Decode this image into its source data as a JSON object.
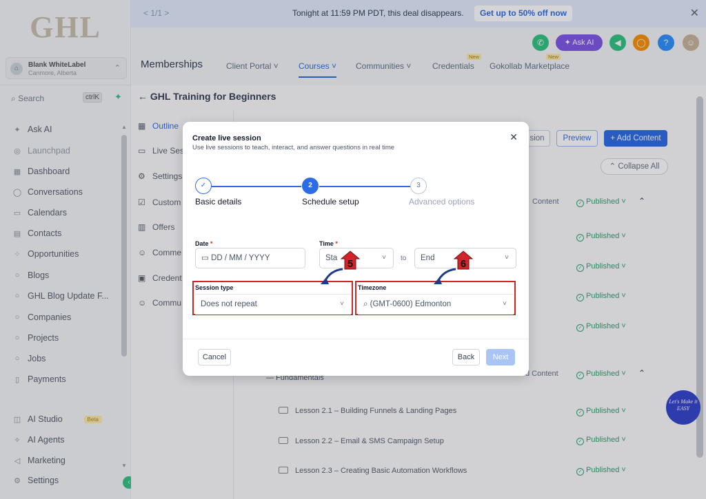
{
  "sidebar": {
    "logo": "GHL",
    "account_name": "Blank WhiteLabel",
    "account_location": "Canmore, Alberta",
    "search_placeholder": "Search",
    "search_shortcut": "ctrlK",
    "items": [
      {
        "label": "Ask AI",
        "icon": "sparkle-icon"
      },
      {
        "label": "Launchpad",
        "icon": "rocket-icon"
      },
      {
        "label": "Dashboard",
        "icon": "grid-icon"
      },
      {
        "label": "Conversations",
        "icon": "chat-icon"
      },
      {
        "label": "Calendars",
        "icon": "calendar-icon"
      },
      {
        "label": "Contacts",
        "icon": "contacts-icon"
      },
      {
        "label": "Opportunities",
        "icon": "funnel-icon"
      },
      {
        "label": "Blogs",
        "icon": "blog-icon"
      },
      {
        "label": "GHL Blog Update F...",
        "icon": "blog-icon"
      },
      {
        "label": "Companies",
        "icon": "building-icon"
      },
      {
        "label": "Projects",
        "icon": "project-icon"
      },
      {
        "label": "Jobs",
        "icon": "briefcase-icon"
      },
      {
        "label": "Payments",
        "icon": "payment-icon"
      },
      {
        "label": "AI Studio",
        "icon": "studio-icon",
        "badge": "Beta"
      },
      {
        "label": "AI Agents",
        "icon": "agents-icon"
      },
      {
        "label": "Marketing",
        "icon": "send-icon"
      },
      {
        "label": "Settings",
        "icon": "gear-icon"
      }
    ]
  },
  "banner": {
    "pager": "< 1/1 >",
    "message": "Tonight at 11:59 PM PDT, this deal disappears.",
    "cta": "Get up to 50% off now"
  },
  "header": {
    "ask_ai": "Ask AI",
    "section_title": "Memberships",
    "tabs": [
      {
        "label": "Client Portal ˅",
        "active": false
      },
      {
        "label": "Courses ˅",
        "active": true
      },
      {
        "label": "Communities ˅",
        "active": false
      },
      {
        "label": "Credentials",
        "active": false,
        "badge": "New"
      },
      {
        "label": "Gokollab Marketplace",
        "active": false,
        "badge": "New"
      }
    ]
  },
  "page": {
    "breadcrumb": "GHL Training for Beginners",
    "left_menu": [
      "Outline",
      "Live Ses",
      "Settings",
      "Custom",
      "Offers",
      "Comme",
      "Credent",
      "Commu"
    ],
    "session_button": "sion",
    "preview_button": "Preview",
    "add_content_button": "+ Add Content",
    "collapse_all": "Collapse All",
    "content_label": "Content",
    "content_label_2": "d Content",
    "published": "Published",
    "module_title": "Fundamentals",
    "lessons": [
      "Lesson 2.1 – Building Funnels & Landing Pages",
      "Lesson 2.2 – Email & SMS Campaign Setup",
      "Lesson 2.3 – Creating Basic Automation Workflows"
    ]
  },
  "modal": {
    "title": "Create live session",
    "subtitle": "Use live sessions to teach, interact, and answer questions in real time",
    "steps": [
      {
        "number": "✓",
        "label": "Basic details",
        "state": "done"
      },
      {
        "number": "2",
        "label": "Schedule setup",
        "state": "current"
      },
      {
        "number": "3",
        "label": "Advanced options",
        "state": "pending"
      }
    ],
    "date_label": "Date",
    "date_placeholder": "DD / MM / YYYY",
    "time_label": "Time",
    "start_placeholder": "Sta",
    "to_text": "to",
    "end_placeholder": "End",
    "session_type_label": "Session type",
    "session_type_value": "Does not repeat",
    "timezone_label": "Timezone",
    "timezone_value": "(GMT-0600) Edmonton",
    "cancel": "Cancel",
    "back": "Back",
    "next": "Next",
    "marker_5": "5",
    "marker_6": "6",
    "accent_color": "#2e6ce6",
    "highlight_color": "#d1232a"
  },
  "floating_badge": "Let's Make it EASY"
}
